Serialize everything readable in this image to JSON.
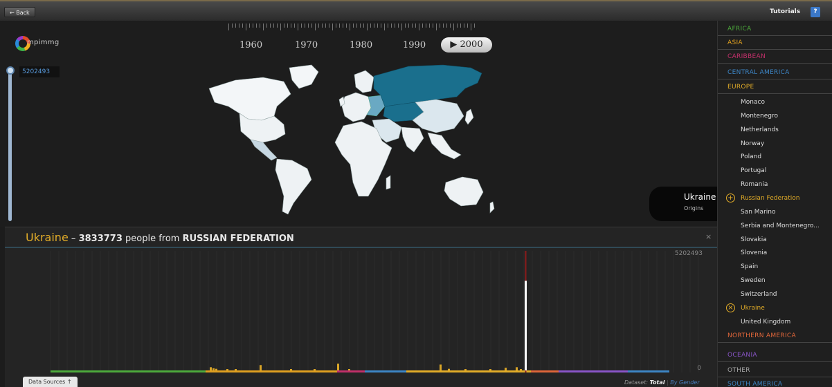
{
  "topbar": {
    "back_label": "← Back",
    "tutorials_label": "Tutorials",
    "help_label": "?"
  },
  "logo": {
    "text": "mpimmg"
  },
  "map": {
    "max_value": "5202493"
  },
  "timeline": {
    "years": [
      "1960",
      "1970",
      "1980",
      "1990"
    ],
    "current_year": "2000",
    "play_icon": "play-icon"
  },
  "tooltip": {
    "country": "Ukraine",
    "subtitle": "Origins"
  },
  "panel": {
    "country": "Ukraine",
    "separator": " – ",
    "count": "3833773",
    "text_people": " people from ",
    "origin": "RUSSIAN FEDERATION",
    "close_label": "×",
    "data_sources_label": "Data Sources ↑",
    "dataset_label": "Dataset: ",
    "dataset_total": "Total",
    "dataset_separator": " | ",
    "dataset_gender": "By Gender"
  },
  "chart_data": {
    "type": "bar",
    "title": "",
    "ylim": [
      0,
      5202493
    ],
    "tick_labels": [
      "5202493",
      "0"
    ],
    "highlight": {
      "name": "RUSSIAN FEDERATION",
      "value": 3833773
    },
    "note": "one bar per origin country, small values along baseline"
  },
  "regions": [
    {
      "label": "AFRICA",
      "color": "#4dab3c"
    },
    {
      "label": "ASIA",
      "color": "#e0a020"
    },
    {
      "label": "CARIBBEAN",
      "color": "#c2306a"
    },
    {
      "label": "CENTRAL AMERICA",
      "color": "#3d86c6"
    },
    {
      "label": "EUROPE",
      "color": "#e3ad28"
    },
    {
      "label": "NORTHERN AMERICA",
      "color": "#e0663a"
    },
    {
      "label": "OCEANIA",
      "color": "#8a55c8"
    },
    {
      "label": "OTHER",
      "color": "#a8a8a8"
    },
    {
      "label": "SOUTH AMERICA",
      "color": "#3d86c6"
    }
  ],
  "europe_countries": [
    "Monaco",
    "Montenegro",
    "Netherlands",
    "Norway",
    "Poland",
    "Portugal",
    "Romania",
    "Russian Federation",
    "San Marino",
    "Serbia and Montenegro...",
    "Slovakia",
    "Slovenia",
    "Spain",
    "Sweden",
    "Switzerland",
    "Ukraine",
    "United Kingdom"
  ],
  "colors": {
    "accent": "#e3ad28",
    "map_highlight": "#1a6f8d",
    "map_land": "#f3f6f8"
  }
}
